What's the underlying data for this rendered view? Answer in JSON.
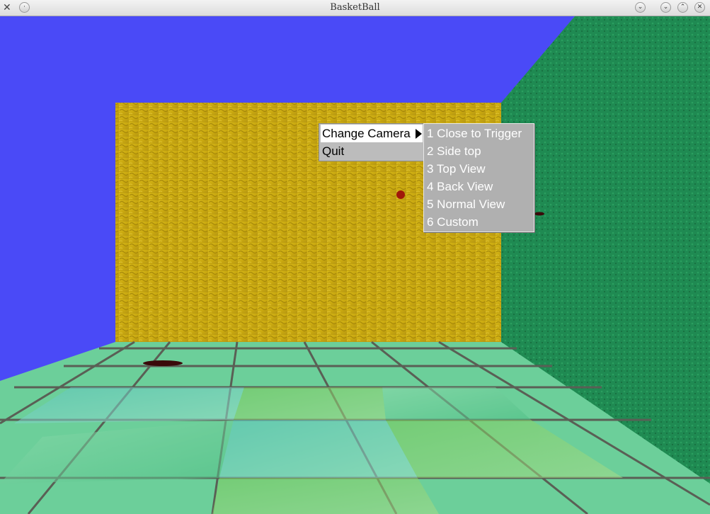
{
  "window": {
    "title": "BasketBall",
    "icon": "tools-icon"
  },
  "scene": {
    "sky_color": "#4a4af7",
    "back_wall_color": "#c8a812",
    "side_wall_color": "#1f8a52",
    "floor_color": "#6ccf9a"
  },
  "context_menu": {
    "items": [
      {
        "label": "Change Camera",
        "has_submenu": true,
        "active": true
      },
      {
        "label": "Quit",
        "has_submenu": false,
        "active": false
      }
    ]
  },
  "camera_submenu": {
    "items": [
      {
        "label": "1 Close to Trigger"
      },
      {
        "label": "2 Side top"
      },
      {
        "label": "3 Top View"
      },
      {
        "label": "4 Back View"
      },
      {
        "label": "5 Normal View"
      },
      {
        "label": "6 Custom"
      }
    ]
  }
}
